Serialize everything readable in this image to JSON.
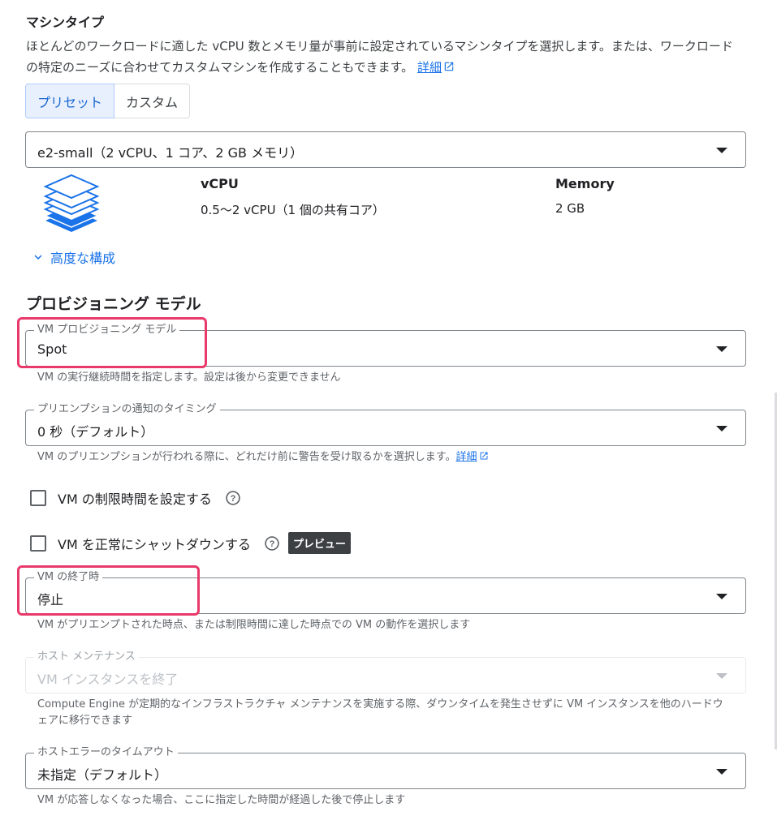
{
  "machine_type": {
    "title": "マシンタイプ",
    "description": "ほとんどのワークロードに適した vCPU 数とメモリ量が事前に設定されているマシンタイプを選択します。または、ワークロードの特定のニーズに合わせてカスタムマシンを作成することもできます。",
    "learn_more": "詳細",
    "tabs": [
      {
        "label": "プリセット",
        "active": true
      },
      {
        "label": "カスタム",
        "active": false
      }
    ],
    "selected": "e2-small（2 vCPU、1 コア、2 GB メモリ）",
    "spec": {
      "vcpu_header": "vCPU",
      "vcpu_value": "0.5〜2 vCPU（1 個の共有コア）",
      "memory_header": "Memory",
      "memory_value": "2 GB"
    },
    "advanced": "高度な構成"
  },
  "provisioning": {
    "title": "プロビジョニング モデル",
    "vm_model": {
      "label": "VM プロビジョニング モデル",
      "value": "Spot",
      "helper": "VM の実行継続時間を指定します。設定は後から変更できません"
    },
    "preemption": {
      "label": "プリエンプションの通知のタイミング",
      "value": "0 秒（デフォルト）",
      "helper": "VM のプリエンプションが行われる際に、どれだけ前に警告を受け取るかを選択します。",
      "learn_more": "詳細"
    },
    "time_limit": {
      "label": "VM の制限時間を設定する",
      "checked": false
    },
    "graceful_shutdown": {
      "label": "VM を正常にシャットダウンする",
      "checked": false,
      "badge": "プレビュー"
    },
    "on_termination": {
      "label": "VM の終了時",
      "value": "停止",
      "helper": "VM がプリエンプトされた時点、または制限時間に達した時点での VM の動作を選択します"
    },
    "host_maintenance": {
      "label": "ホスト メンテナンス",
      "value": "VM インスタンスを終了",
      "helper": "Compute Engine が定期的なインフラストラクチャ メンテナンスを実施する際、ダウンタイムを発生させずに VM インスタンスを他のハードウェアに移行できます",
      "disabled": true
    },
    "host_error_timeout": {
      "label": "ホストエラーのタイムアウト",
      "value": "未指定（デフォルト）",
      "helper": "VM が応答しなくなった場合、ここに指定した時間が経過した後で停止します"
    }
  },
  "colors": {
    "accent": "#1a73e8",
    "highlight": "#e8396a"
  }
}
